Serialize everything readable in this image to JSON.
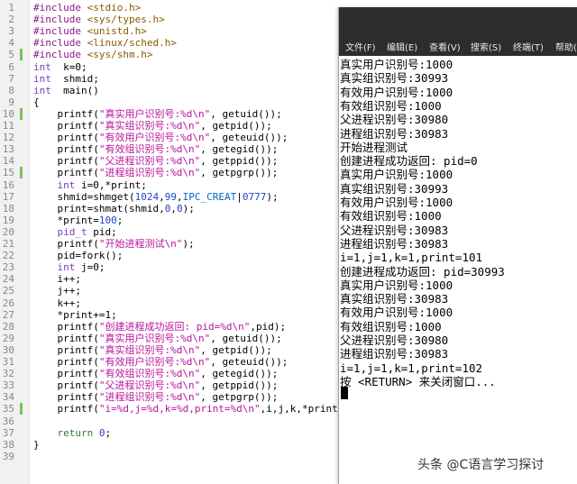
{
  "editor": {
    "lines": [
      {
        "n": "1",
        "segs": [
          [
            "ppk",
            "#include "
          ],
          [
            "ppv",
            "<stdio.h>"
          ]
        ]
      },
      {
        "n": "2",
        "segs": [
          [
            "ppk",
            "#include "
          ],
          [
            "ppv",
            "<sys/types.h>"
          ]
        ]
      },
      {
        "n": "3",
        "segs": [
          [
            "ppk",
            "#include "
          ],
          [
            "ppv",
            "<unistd.h>"
          ]
        ]
      },
      {
        "n": "4",
        "segs": [
          [
            "ppk",
            "#include "
          ],
          [
            "ppv",
            "<linux/sched.h>"
          ]
        ]
      },
      {
        "n": "5",
        "mark": true,
        "segs": [
          [
            "ppk",
            "#include "
          ],
          [
            "ppv",
            "<sys/shm.h>"
          ]
        ]
      },
      {
        "n": "6",
        "segs": [
          [
            "ty",
            "int"
          ],
          [
            "",
            "  k=0;"
          ]
        ]
      },
      {
        "n": "7",
        "segs": [
          [
            "ty",
            "int"
          ],
          [
            "",
            "  shmid;"
          ]
        ]
      },
      {
        "n": "8",
        "segs": [
          [
            "ty",
            "int"
          ],
          [
            "",
            "  main()"
          ]
        ]
      },
      {
        "n": "9",
        "segs": [
          [
            "",
            "{"
          ]
        ]
      },
      {
        "n": "10",
        "mark": true,
        "segs": [
          [
            "",
            "    printf("
          ],
          [
            "str",
            "\"真实用户识别号:%d\\n\""
          ],
          [
            "",
            ", getuid());"
          ]
        ]
      },
      {
        "n": "11",
        "segs": [
          [
            "",
            "    printf("
          ],
          [
            "str",
            "\"真实组识别号:%d\\n\""
          ],
          [
            "",
            ", getpid());"
          ]
        ]
      },
      {
        "n": "12",
        "segs": [
          [
            "",
            "    printf("
          ],
          [
            "str",
            "\"有效用户识别号:%d\\n\""
          ],
          [
            "",
            ", geteuid());"
          ]
        ]
      },
      {
        "n": "13",
        "segs": [
          [
            "",
            "    printf("
          ],
          [
            "str",
            "\"有效组识别号:%d\\n\""
          ],
          [
            "",
            ", getegid());"
          ]
        ]
      },
      {
        "n": "14",
        "segs": [
          [
            "",
            "    printf("
          ],
          [
            "str",
            "\"父进程识别号:%d\\n\""
          ],
          [
            "",
            ", getppid());"
          ]
        ]
      },
      {
        "n": "15",
        "mark": true,
        "segs": [
          [
            "",
            "    printf("
          ],
          [
            "str",
            "\"进程组识别号:%d\\n\""
          ],
          [
            "",
            ", getpgrp());"
          ]
        ]
      },
      {
        "n": "16",
        "segs": [
          [
            "",
            "    "
          ],
          [
            "ty",
            "int"
          ],
          [
            "",
            " i=0,*print;"
          ]
        ]
      },
      {
        "n": "17",
        "segs": [
          [
            "",
            "    shmid=shmget("
          ],
          [
            "num",
            "1024"
          ],
          [
            "",
            ","
          ],
          [
            "num",
            "99"
          ],
          [
            "",
            ","
          ],
          [
            "cn",
            "IPC_CREAT"
          ],
          [
            "",
            "|"
          ],
          [
            "num",
            "0777"
          ],
          [
            "",
            ");"
          ]
        ]
      },
      {
        "n": "18",
        "segs": [
          [
            "",
            "    print=shmat(shmid,"
          ],
          [
            "num",
            "0"
          ],
          [
            "",
            ","
          ],
          [
            "num",
            "0"
          ],
          [
            "",
            ");"
          ]
        ]
      },
      {
        "n": "19",
        "segs": [
          [
            "",
            "    *print="
          ],
          [
            "num",
            "100"
          ],
          [
            "",
            ";"
          ]
        ]
      },
      {
        "n": "20",
        "segs": [
          [
            "",
            "    "
          ],
          [
            "ty",
            "pid_t"
          ],
          [
            "",
            " pid;"
          ]
        ]
      },
      {
        "n": "21",
        "segs": [
          [
            "",
            "    printf("
          ],
          [
            "str",
            "\"开始进程测试\\n\""
          ],
          [
            "",
            ");"
          ]
        ]
      },
      {
        "n": "22",
        "segs": [
          [
            "",
            "    pid=fork();"
          ]
        ]
      },
      {
        "n": "23",
        "segs": [
          [
            "",
            "    "
          ],
          [
            "ty",
            "int"
          ],
          [
            "",
            " j=0;"
          ]
        ]
      },
      {
        "n": "24",
        "segs": [
          [
            "",
            "    i++;"
          ]
        ]
      },
      {
        "n": "25",
        "segs": [
          [
            "",
            "    j++;"
          ]
        ]
      },
      {
        "n": "26",
        "segs": [
          [
            "",
            "    k++;"
          ]
        ]
      },
      {
        "n": "27",
        "segs": [
          [
            "",
            "    *print+=1;"
          ]
        ]
      },
      {
        "n": "28",
        "segs": [
          [
            "",
            "    printf("
          ],
          [
            "str",
            "\"创建进程成功返回: pid=%d\\n\""
          ],
          [
            "",
            ",pid);"
          ]
        ]
      },
      {
        "n": "29",
        "segs": [
          [
            "",
            "    printf("
          ],
          [
            "str",
            "\"真实用户识别号:%d\\n\""
          ],
          [
            "",
            ", getuid());"
          ]
        ]
      },
      {
        "n": "30",
        "segs": [
          [
            "",
            "    printf("
          ],
          [
            "str",
            "\"真实组识别号:%d\\n\""
          ],
          [
            "",
            ", getpid());"
          ]
        ]
      },
      {
        "n": "31",
        "segs": [
          [
            "",
            "    printf("
          ],
          [
            "str",
            "\"有效用户识别号:%d\\n\""
          ],
          [
            "",
            ", geteuid());"
          ]
        ]
      },
      {
        "n": "32",
        "segs": [
          [
            "",
            "    printf("
          ],
          [
            "str",
            "\"有效组识别号:%d\\n\""
          ],
          [
            "",
            ", getegid());"
          ]
        ]
      },
      {
        "n": "33",
        "segs": [
          [
            "",
            "    printf("
          ],
          [
            "str",
            "\"父进程识别号:%d\\n\""
          ],
          [
            "",
            ", getppid());"
          ]
        ]
      },
      {
        "n": "34",
        "segs": [
          [
            "",
            "    printf("
          ],
          [
            "str",
            "\"进程组识别号:%d\\n\""
          ],
          [
            "",
            ", getpgrp());"
          ]
        ]
      },
      {
        "n": "35",
        "mark": true,
        "segs": [
          [
            "",
            "    printf("
          ],
          [
            "str",
            "\"i=%d,j=%d,k=%d,print=%d\\n\""
          ],
          [
            "",
            ",i,j,k,*print);"
          ]
        ]
      },
      {
        "n": "36",
        "segs": [
          [
            "",
            ""
          ]
        ]
      },
      {
        "n": "37",
        "segs": [
          [
            "",
            "    "
          ],
          [
            "kw",
            "return"
          ],
          [
            "",
            " "
          ],
          [
            "num",
            "0"
          ],
          [
            "",
            ";"
          ]
        ]
      },
      {
        "n": "38",
        "segs": [
          [
            "",
            "}"
          ]
        ]
      },
      {
        "n": "39",
        "segs": [
          [
            "",
            ""
          ]
        ]
      }
    ]
  },
  "terminal": {
    "menu": [
      "文件(F)",
      "编辑(E)",
      "查看(V)",
      "搜索(S)",
      "终端(T)",
      "帮助("
    ],
    "output": [
      "真实用户识别号:1000",
      "真实组识别号:30993",
      "有效用户识别号:1000",
      "有效组识别号:1000",
      "父进程识别号:30980",
      "进程组识别号:30983",
      "开始进程测试",
      "创建进程成功返回: pid=0",
      "真实用户识别号:1000",
      "真实组识别号:30993",
      "有效用户识别号:1000",
      "有效组识别号:1000",
      "父进程识别号:30983",
      "进程组识别号:30983",
      "i=1,j=1,k=1,print=101",
      "创建进程成功返回: pid=30993",
      "真实用户识别号:1000",
      "真实组识别号:30983",
      "有效用户识别号:1000",
      "有效组识别号:1000",
      "父进程识别号:30980",
      "进程组识别号:30983",
      "i=1,j=1,k=1,print=102",
      "按 <RETURN> 来关闭窗口..."
    ]
  },
  "watermark": "头条 @C语言学习探讨"
}
